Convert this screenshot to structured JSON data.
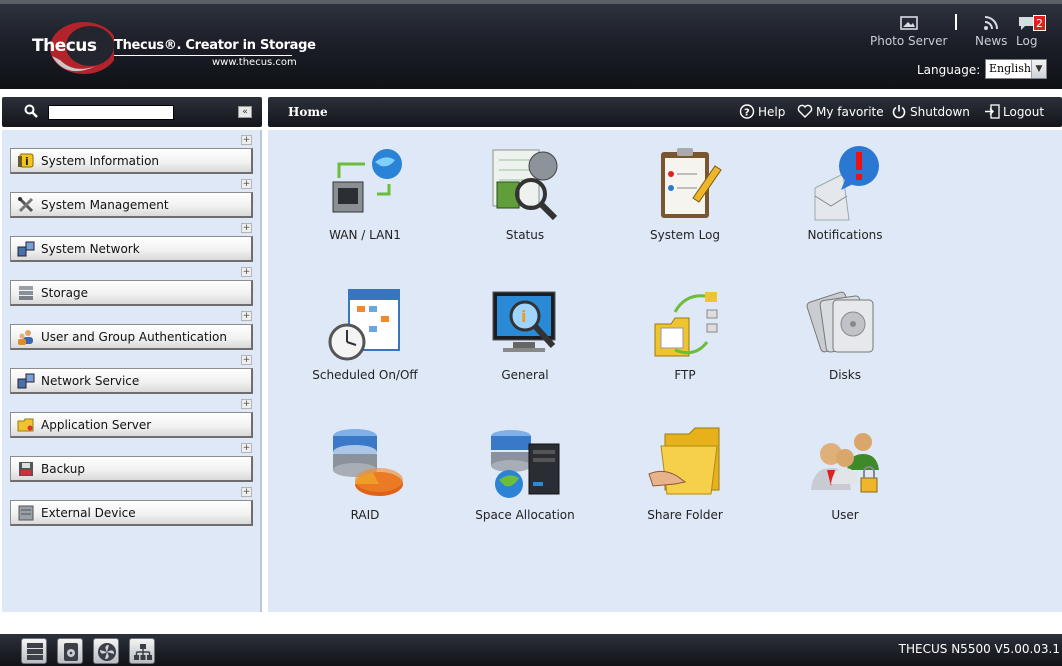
{
  "header": {
    "logo_text": "Thecus",
    "tagline": "Thecus®. Creator in Storage",
    "url": "www.thecus.com",
    "tools": [
      {
        "label": "Photo Server",
        "icon": "photo-icon"
      },
      {
        "label": "News",
        "icon": "rss-icon"
      },
      {
        "label": "Log",
        "icon": "log-icon",
        "badge": "2"
      }
    ],
    "language_label": "Language:",
    "language_value": "English"
  },
  "sidebar": {
    "search_value": "",
    "collapse_glyph": "«",
    "items": [
      {
        "label": "System Information",
        "icon": "info-icon"
      },
      {
        "label": "System Management",
        "icon": "tools-icon"
      },
      {
        "label": "System Network",
        "icon": "network-icon"
      },
      {
        "label": "Storage",
        "icon": "storage-icon"
      },
      {
        "label": "User and Group Authentication",
        "icon": "users-icon"
      },
      {
        "label": "Network Service",
        "icon": "network-service-icon"
      },
      {
        "label": "Application Server",
        "icon": "folder-icon"
      },
      {
        "label": "Backup",
        "icon": "backup-icon"
      },
      {
        "label": "External Device",
        "icon": "external-device-icon"
      }
    ]
  },
  "toolbar": {
    "breadcrumb": "Home",
    "help": "Help",
    "favorite": "My favorite",
    "shutdown": "Shutdown",
    "logout": "Logout"
  },
  "apps": [
    {
      "label": "WAN / LAN1",
      "icon": "wan-lan-icon"
    },
    {
      "label": "Status",
      "icon": "status-icon"
    },
    {
      "label": "System Log",
      "icon": "system-log-icon"
    },
    {
      "label": "Notifications",
      "icon": "notifications-icon"
    },
    {
      "label": "Scheduled On/Off",
      "icon": "schedule-icon"
    },
    {
      "label": "General",
      "icon": "general-icon"
    },
    {
      "label": "FTP",
      "icon": "ftp-icon"
    },
    {
      "label": "Disks",
      "icon": "disks-icon"
    },
    {
      "label": "RAID",
      "icon": "raid-icon"
    },
    {
      "label": "Space Allocation",
      "icon": "space-allocation-icon"
    },
    {
      "label": "Share Folder",
      "icon": "share-folder-icon"
    },
    {
      "label": "User",
      "icon": "user-icon"
    }
  ],
  "footer": {
    "buttons": [
      "server-icon",
      "disk-icon",
      "fan-icon",
      "network-tree-icon"
    ],
    "model": "THECUS N5500 V5.00.03.1"
  },
  "colors": {
    "panel_bg": "#dfe8f6",
    "header_dark": "#1d2029",
    "badge_red": "#e21d1d",
    "brand_red": "#b3232b"
  }
}
